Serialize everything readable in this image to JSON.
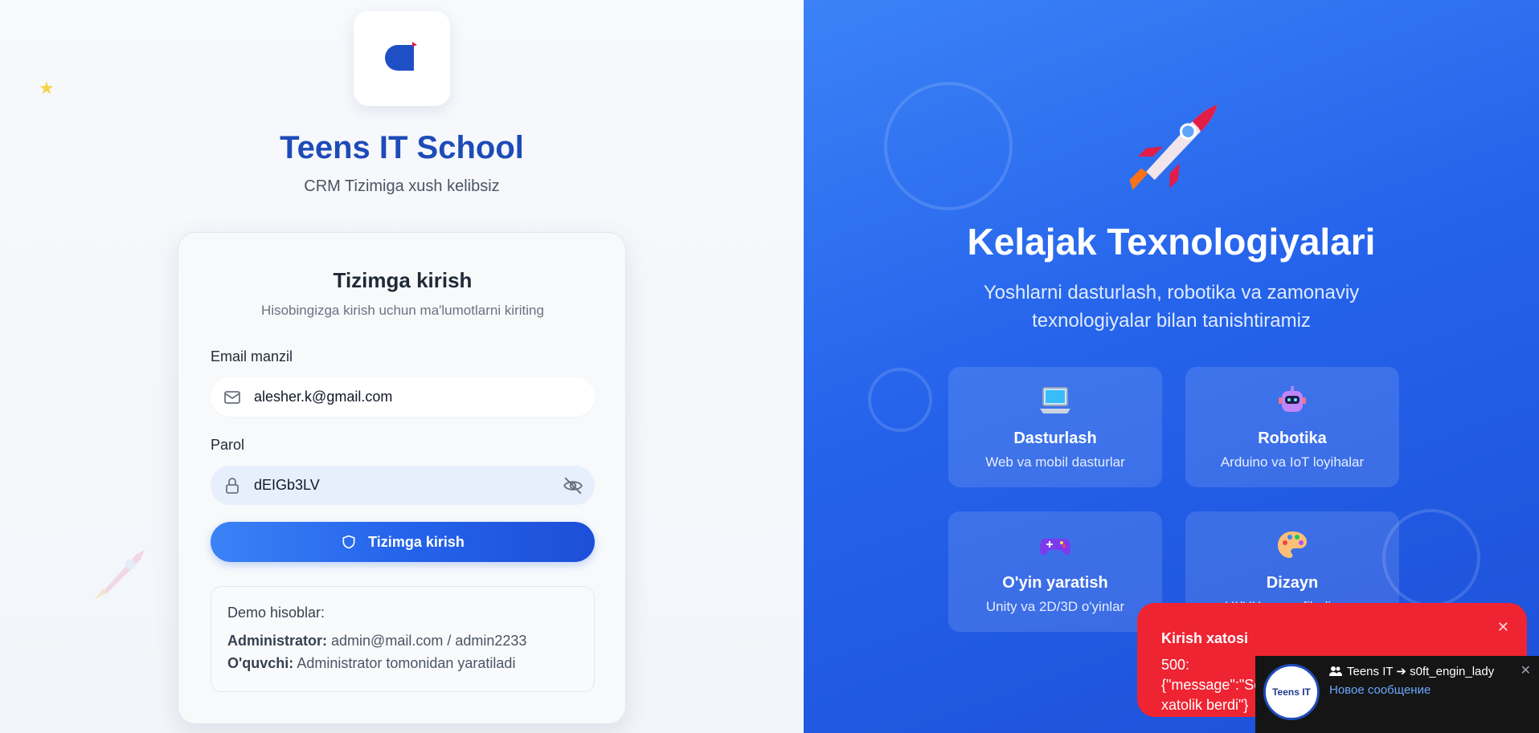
{
  "brand": {
    "title": "Teens IT School",
    "subtitle": "CRM Tizimiga xush kelibsiz",
    "accent": "#1e4bb8"
  },
  "login": {
    "title": "Tizimga kirish",
    "subtitle": "Hisobingizga kirish uchun ma'lumotlarni kiriting",
    "email_label": "Email manzil",
    "email_value": "alesher.k@gmail.com",
    "password_label": "Parol",
    "password_value": "dEIGb3LV",
    "submit_label": "Tizimga kirish"
  },
  "demo": {
    "title": "Demo hisoblar:",
    "admin_label": "Administrator:",
    "admin_value": "admin@mail.com / admin2233",
    "student_label": "O'quvchi:",
    "student_value": "Administrator tomonidan yaratiladi"
  },
  "hero": {
    "title": "Kelajak Texnologiyalari",
    "subtitle": "Yoshlarni dasturlash, robotika va zamonaviy texnologiyalar bilan tanishtiramiz",
    "features": [
      {
        "icon": "laptop-icon",
        "title": "Dasturlash",
        "desc": "Web va mobil dasturlar"
      },
      {
        "icon": "robot-icon",
        "title": "Robotika",
        "desc": "Arduino va IoT loyihalar"
      },
      {
        "icon": "gamepad-icon",
        "title": "O'yin yaratish",
        "desc": "Unity va 2D/3D o'yinlar"
      },
      {
        "icon": "palette-icon",
        "title": "Dizayn",
        "desc": "UI/UX va grafik dizayn"
      }
    ]
  },
  "toast_error": {
    "title": "Kirish xatosi",
    "message": "500: {\"message\":\"Server xatolik berdi\"}",
    "color": "#ef2432"
  },
  "notification": {
    "avatar_text": "Teens IT",
    "header": "Teens IT ➔ s0ft_engin_lady",
    "text": "Новое сообщение"
  }
}
